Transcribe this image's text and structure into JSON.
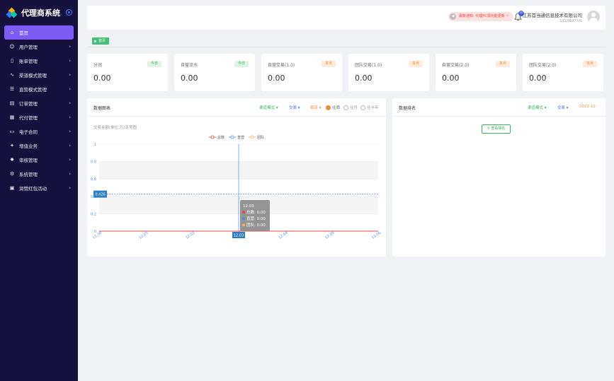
{
  "app": {
    "title": "代理商系统"
  },
  "colors": {
    "sidebar_bg": "#15103e",
    "active_menu": "#7b5cf5",
    "green": "#3bb05d",
    "orange": "#f08b3b",
    "blue": "#4b6cf5"
  },
  "sidebar": {
    "items": [
      {
        "label": "首页",
        "icon": "home-icon"
      },
      {
        "label": "用户管理",
        "icon": "users-icon"
      },
      {
        "label": "账单管理",
        "icon": "clipboard-icon"
      },
      {
        "label": "渠道模式管理",
        "icon": "activity-icon"
      },
      {
        "label": "直营模式管理",
        "icon": "database-icon"
      },
      {
        "label": "订单管理",
        "icon": "document-icon"
      },
      {
        "label": "代付管理",
        "icon": "layout-icon"
      },
      {
        "label": "电子合同",
        "icon": "contract-icon"
      },
      {
        "label": "增值业务",
        "icon": "star-gear-icon"
      },
      {
        "label": "审核管理",
        "icon": "cog-icon"
      },
      {
        "label": "系统管理",
        "icon": "settings-icon"
      },
      {
        "label": "润赞红包活动",
        "icon": "gift-icon"
      }
    ]
  },
  "header": {
    "notice": "最新通知: 代理PC源功能更新 ~",
    "bell_badge": "10",
    "company": "江苏首当通信息技术有限公司",
    "phone": "15579037776"
  },
  "tags": {
    "home": "首页"
  },
  "cards": [
    {
      "label": "分润",
      "pill": "今日",
      "value": "0.00",
      "pill_color": "green"
    },
    {
      "label": "自营流水",
      "pill": "今日",
      "value": "0.00",
      "pill_color": "green"
    },
    {
      "label": "自营交易(1.0)",
      "pill": "本月",
      "value": "0.00",
      "pill_color": "orange"
    },
    {
      "label": "团队交易(1.0)",
      "pill": "本月",
      "value": "0.00",
      "pill_color": "orange"
    },
    {
      "label": "自营交易(2.0)",
      "pill": "本月",
      "value": "0.00",
      "pill_color": "orange"
    },
    {
      "label": "团队交易(2.0)",
      "pill": "本月",
      "value": "0.00",
      "pill_color": "orange"
    }
  ],
  "chart_panel": {
    "title": "数据图表",
    "mode_select": "渠道模式",
    "type_select": "交易",
    "period_select": "按日",
    "radio_options": [
      "往周",
      "往月",
      "往半年"
    ],
    "radio_selected": 0,
    "subtitle": "交易金额(单位:万)走势图",
    "tooltip": {
      "title": "12.03",
      "rows": [
        {
          "label": "总数: 0.00",
          "color": "#e6443f"
        },
        {
          "label": "直营: 0.00",
          "color": "#4b8cf5"
        },
        {
          "label": "团队: 0.00",
          "color": "#f5b06b"
        }
      ]
    }
  },
  "chart_data": {
    "type": "line",
    "x": [
      "11.30",
      "12.01",
      "12.02",
      "12.03",
      "12.04",
      "12.05",
      "12.06"
    ],
    "series": [
      {
        "name": "总数",
        "values": [
          0,
          0,
          0,
          0,
          0,
          0,
          0
        ],
        "color": "#e6443f"
      },
      {
        "name": "直营",
        "values": [
          0,
          0,
          0,
          0,
          0,
          0,
          0
        ],
        "color": "#4b8cf5"
      },
      {
        "name": "团队",
        "values": [
          0,
          0,
          0,
          0,
          0,
          0,
          0
        ],
        "color": "#f5b06b"
      }
    ],
    "ylim": [
      0,
      1
    ],
    "yticks": [
      "0",
      "0.2",
      "0.4",
      "0.6",
      "0.8",
      "1"
    ],
    "crosshair": {
      "x": "12.03",
      "y_value": 0.426,
      "y_label": "0.426"
    },
    "legend": "top-center",
    "grid": true
  },
  "rank_panel": {
    "title": "数据排名",
    "mode_select": "渠道模式",
    "type_select": "交易",
    "date": "2022-12",
    "button": "查看排名"
  }
}
